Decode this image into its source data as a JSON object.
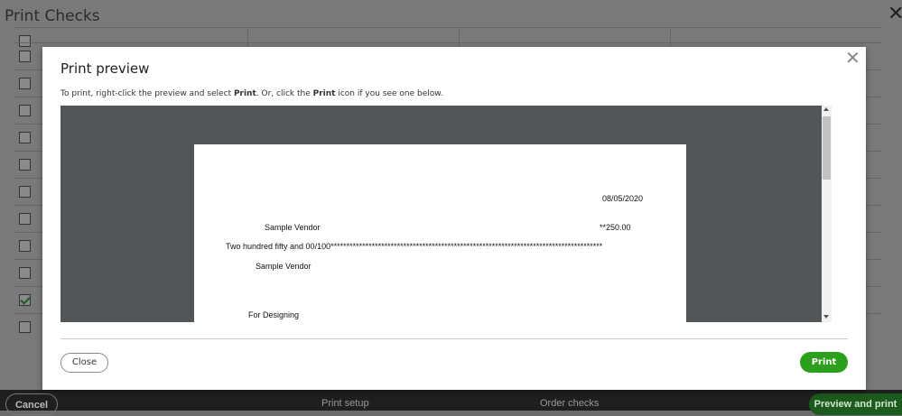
{
  "background": {
    "title": "Print Checks",
    "footer": {
      "cancel_label": "Cancel",
      "print_setup_label": "Print setup",
      "order_checks_label": "Order checks",
      "preview_and_print_label": "Preview and print"
    },
    "rows": [
      {
        "checked": false
      },
      {
        "checked": false
      },
      {
        "checked": false
      },
      {
        "checked": false
      },
      {
        "checked": false
      },
      {
        "checked": false
      },
      {
        "checked": false
      },
      {
        "checked": false
      },
      {
        "checked": false
      },
      {
        "checked": false
      },
      {
        "checked": true
      },
      {
        "checked": false
      }
    ]
  },
  "modal": {
    "title": "Print preview",
    "instructions": {
      "part1": "To print, right-click the preview and select ",
      "bold1": "Print",
      "part2": ". Or, click the ",
      "bold2": "Print",
      "part3": " icon if you see one below."
    },
    "check": {
      "date": "08/05/2020",
      "payee": "Sample Vendor",
      "amount": "**250.00",
      "amount_words": "Two hundred fifty and 00/100**************************************************************************************",
      "address_name": "Sample Vendor",
      "memo": "For Designing"
    },
    "close_label": "Close",
    "print_label": "Print"
  },
  "colors": {
    "primary_green": "#2ca01c",
    "viewer_bg": "#525659"
  }
}
